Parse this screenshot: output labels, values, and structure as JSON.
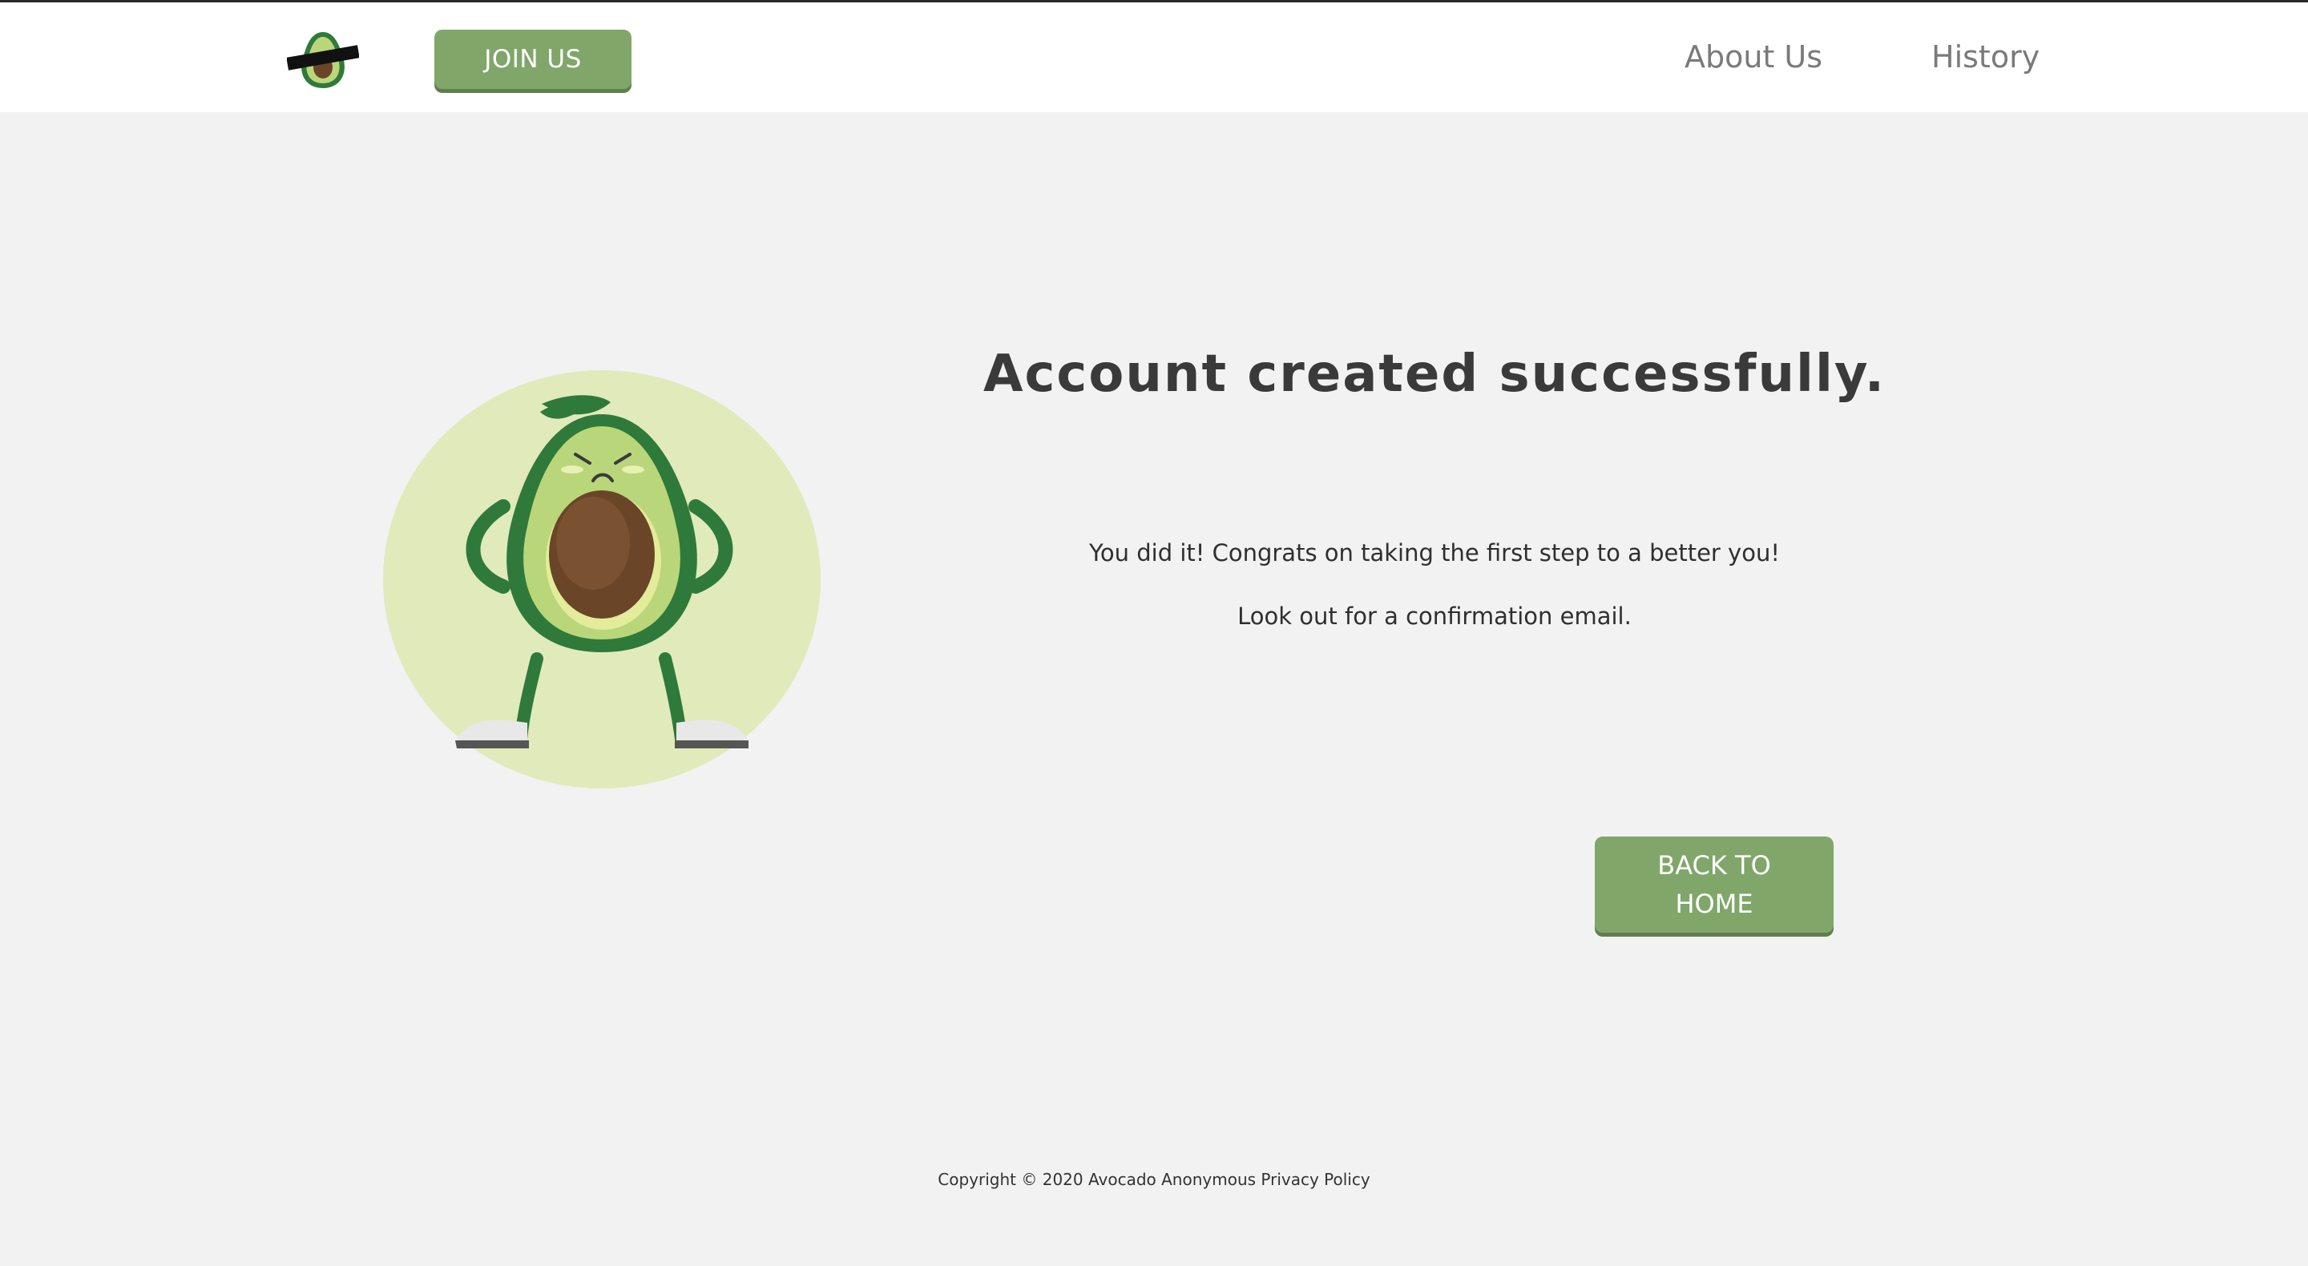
{
  "header": {
    "logo_icon": "avocado-logo-icon",
    "join_label": "JOIN US",
    "nav": [
      {
        "label": "About Us"
      },
      {
        "label": "History"
      }
    ]
  },
  "main": {
    "illustration_icon": "angry-avocado-icon",
    "title": "Account created successfully.",
    "message_1": "You did it! Congrats on taking the first step to a better you!",
    "message_2": "Look out for a confirmation email.",
    "back_label": "BACK TO HOME"
  },
  "footer": {
    "text": "Copyright © 2020 Avocado Anonymous Privacy Policy"
  },
  "colors": {
    "accent": "#80a66a",
    "background": "#f2f2f2",
    "header": "#ffffff",
    "circle": "#e1eabb"
  }
}
